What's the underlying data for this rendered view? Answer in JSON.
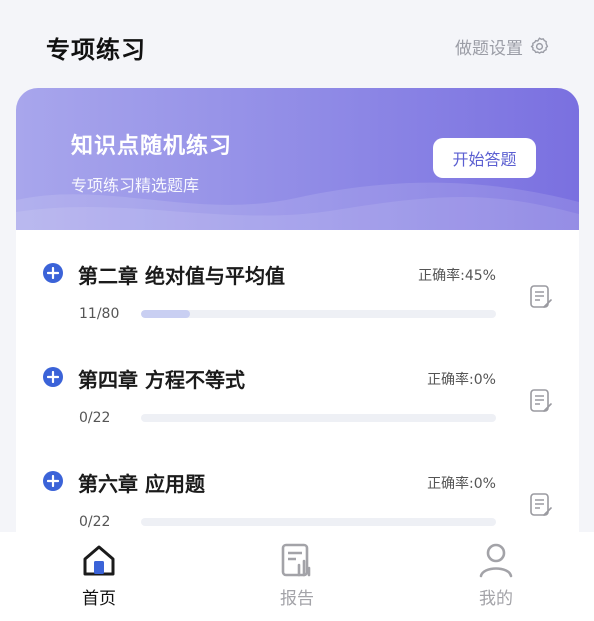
{
  "header": {
    "title": "专项练习",
    "settings_label": "做题设置",
    "settings_icon": "gear-icon"
  },
  "banner": {
    "title": "知识点随机练习",
    "subtitle": "专项练习精选题库",
    "button_label": "开始答题"
  },
  "chapters": [
    {
      "name": "第二章 绝对值与平均值",
      "rate": "正确率:45%",
      "count": "11/80",
      "progress": 0.1375
    },
    {
      "name": "第四章 方程不等式",
      "rate": "正确率:0%",
      "count": "0/22",
      "progress": 0
    },
    {
      "name": "第六章 应用题",
      "rate": "正确率:0%",
      "count": "0/22",
      "progress": 0
    }
  ],
  "tabs": [
    {
      "label": "首页",
      "icon": "home-icon",
      "active": true
    },
    {
      "label": "报告",
      "icon": "report-icon",
      "active": false
    },
    {
      "label": "我的",
      "icon": "user-icon",
      "active": false
    }
  ],
  "colors": {
    "accent": "#3b63d8",
    "banner_start": "#a8a6ec",
    "banner_end": "#7a70e0",
    "button_text": "#5b5fd1"
  }
}
